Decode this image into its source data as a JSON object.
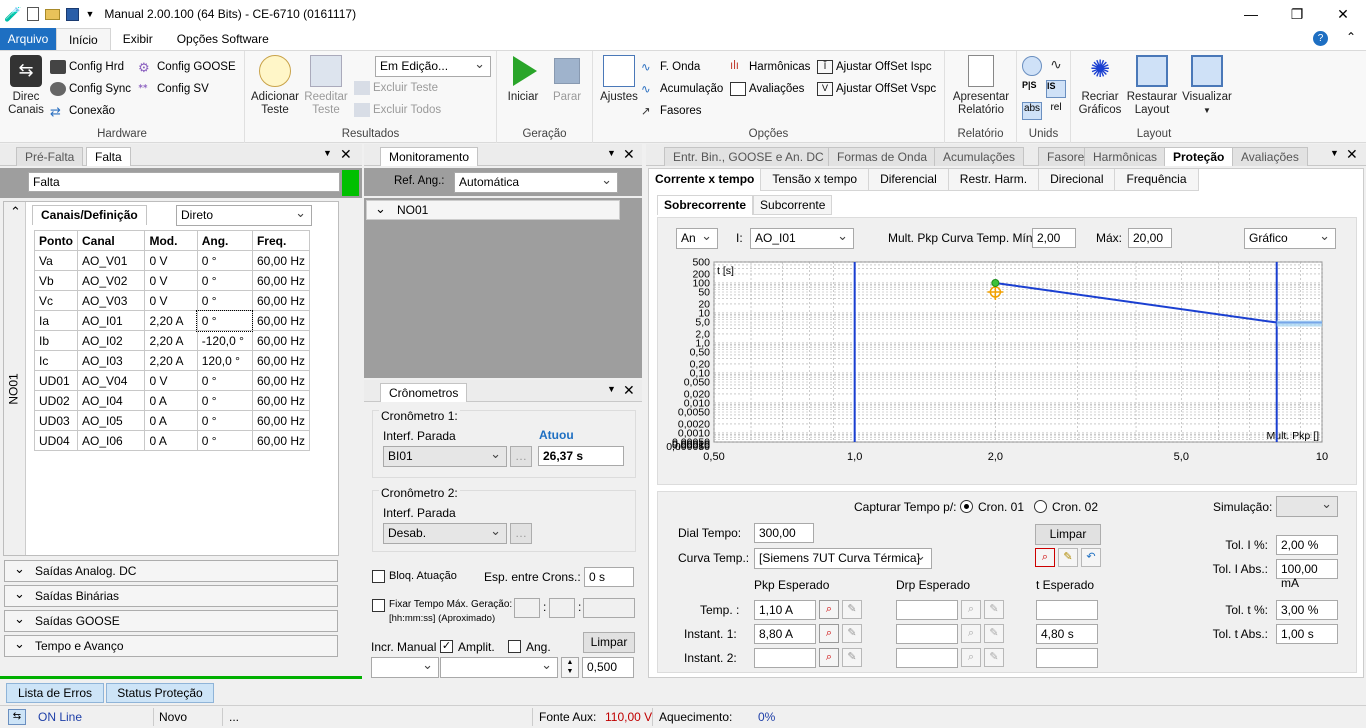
{
  "window": {
    "title": "Manual 2.00.100 (64 Bits) - CE-6710 (0161117)"
  },
  "ribbon_tabs": [
    "Arquivo",
    "Início",
    "Exibir",
    "Opções Software"
  ],
  "ribbon": {
    "hardware": {
      "label": "Hardware",
      "direc": "Direc\nCanais",
      "config_hrd": "Config Hrd",
      "config_sync": "Config Sync",
      "conexao": "Conexão",
      "config_goose": "Config GOOSE",
      "config_sv": "Config SV"
    },
    "resultados": {
      "label": "Resultados",
      "adicionar": "Adicionar\nTeste",
      "reeditar": "Reeditar\nTeste",
      "status": "Em Edição...",
      "excluir_teste": "Excluir Teste",
      "excluir_todos": "Excluir Todos"
    },
    "geracao": {
      "label": "Geração",
      "iniciar": "Iniciar",
      "parar": "Parar"
    },
    "opcoes": {
      "label": "Opções",
      "ajustes": "Ajustes",
      "f_onda": "F. Onda",
      "acumulacao": "Acumulação",
      "fasores": "Fasores",
      "harmonicas": "Harmônicas",
      "avaliacoes": "Avaliações",
      "offset_ispc": "Ajustar OffSet Ispc",
      "offset_vspc": "Ajustar OffSet Vspc"
    },
    "relatorio": {
      "label": "Relatório",
      "apresentar": "Apresentar\nRelatório"
    },
    "unids": {
      "label": "Unids",
      "abs": "abs",
      "rel": "rel"
    },
    "layout": {
      "label": "Layout",
      "recriar": "Recriar\nGráficos",
      "restaurar": "Restaurar\nLayout",
      "visualizar": "Visualizar"
    }
  },
  "left_panel": {
    "tabs": [
      "Pré-Falta",
      "Falta"
    ],
    "state": "Falta",
    "side_label": "NO01",
    "subtab": "Canais/Definição",
    "mode": "Direto",
    "columns": [
      "Ponto",
      "Canal",
      "Mod.",
      "Ang.",
      "Freq."
    ],
    "rows": [
      [
        "Va",
        "AO_V01",
        "0 V",
        "0 °",
        "60,00 Hz"
      ],
      [
        "Vb",
        "AO_V02",
        "0 V",
        "0 °",
        "60,00 Hz"
      ],
      [
        "Vc",
        "AO_V03",
        "0 V",
        "0 °",
        "60,00 Hz"
      ],
      [
        "Ia",
        "AO_I01",
        "2,20 A",
        "0 °",
        "60,00 Hz"
      ],
      [
        "Ib",
        "AO_I02",
        "2,20 A",
        "-120,0 °",
        "60,00 Hz"
      ],
      [
        "Ic",
        "AO_I03",
        "2,20 A",
        "120,0 °",
        "60,00 Hz"
      ],
      [
        "UD01",
        "AO_V04",
        "0 V",
        "0 °",
        "60,00 Hz"
      ],
      [
        "UD02",
        "AO_I04",
        "0 A",
        "0 °",
        "60,00 Hz"
      ],
      [
        "UD03",
        "AO_I05",
        "0 A",
        "0 °",
        "60,00 Hz"
      ],
      [
        "UD04",
        "AO_I06",
        "0 A",
        "0 °",
        "60,00 Hz"
      ]
    ],
    "sections": [
      "Saídas Analog. DC",
      "Saídas Binárias",
      "Saídas GOOSE",
      "Tempo e Avanço"
    ]
  },
  "monitor": {
    "title": "Monitoramento",
    "ref_label": "Ref. Ang.:",
    "ref_value": "Automática",
    "node": "NO01"
  },
  "crono": {
    "title": "Crônometros",
    "c1_title": "Cronômetro 1:",
    "c1_interf": "Interf. Parada",
    "c1_value": "BI01",
    "atuou": "Atuou",
    "c1_time": "26,37 s",
    "c2_title": "Cronômetro 2:",
    "c2_interf": "Interf. Parada",
    "c2_value": "Desab.",
    "bloq": "Bloq. Atuação",
    "esp": "Esp. entre Crons.:",
    "esp_value": "0 s",
    "fixar": "Fixar Tempo Máx. Geração:",
    "fixar_hint": "[hh:mm:ss] (Aproximado)",
    "incr": "Incr. Manual",
    "amplit": "Amplit.",
    "ang": "Ang.",
    "limpar": "Limpar",
    "step": "0,500"
  },
  "right_panel": {
    "tabs": [
      "Entr. Bin., GOOSE e An. DC",
      "Formas de Onda",
      "Acumulações",
      "Fasores",
      "Harmônicas",
      "Proteção",
      "Avaliações"
    ],
    "active_tab": "Proteção",
    "subtabs": [
      "Corrente x tempo",
      "Tensão x tempo",
      "Diferencial",
      "Restr. Harm.",
      "Direcional",
      "Frequência"
    ],
    "subsubtabs": [
      "Sobrecorrente",
      "Subcorrente"
    ],
    "fn": "An",
    "i_label": "I:",
    "i_value": "AO_I01",
    "mult_label": "Mult. Pkp Curva Temp. Mín:",
    "mult_min": "2,00",
    "max_label": "Máx:",
    "mult_max": "20,00",
    "view": "Gráfico",
    "capturar": "Capturar Tempo p/:",
    "cron01": "Cron. 01",
    "cron02": "Cron. 02",
    "simulacao": "Simulação:",
    "dial_label": "Dial Tempo:",
    "dial": "300,00",
    "limpar": "Limpar",
    "curva_label": "Curva Temp.:",
    "curva": "[Siemens 7UT Curva Térmica]",
    "pkp_hdr": "Pkp Esperado",
    "drp_hdr": "Drp Esperado",
    "t_hdr": "t Esperado",
    "rows": [
      {
        "label": "Temp. :",
        "pkp": "1,10 A",
        "drp": "",
        "t": ""
      },
      {
        "label": "Instant. 1:",
        "pkp": "8,80 A",
        "drp": "",
        "t": "4,80 s"
      },
      {
        "label": "Instant. 2:",
        "pkp": "",
        "drp": "",
        "t": ""
      }
    ],
    "tol": [
      {
        "label": "Tol. I %:",
        "value": "2,00 %"
      },
      {
        "label": "Tol. I Abs.:",
        "value": "100,00 mA"
      },
      {
        "label": "Tol. t %:",
        "value": "3,00 %"
      },
      {
        "label": "Tol. t Abs.:",
        "value": "1,00 s"
      }
    ]
  },
  "chart_data": {
    "type": "line",
    "x_scale": "log",
    "y_scale": "log",
    "ylabel": "t [s]",
    "xlabel": "Mult. Pkp []",
    "xlim": [
      0.5,
      10
    ],
    "ylim": [
      0.0005,
      500
    ],
    "x_ticks": [
      "0,50",
      "1,0",
      "2,0",
      "5,0",
      "10"
    ],
    "y_ticks": [
      "500",
      "200",
      "100",
      "50",
      "20",
      "10",
      "5,0",
      "2,0",
      "1,0",
      "0,50",
      "0,20",
      "0,10",
      "0,050",
      "0,020",
      "0,010",
      "0,0050",
      "0,0020",
      "0,0010",
      "0,00050",
      "0,00020",
      "0,00010",
      "0,000050"
    ],
    "series": [
      {
        "x": [
          2.0,
          8.0,
          8.0,
          10.0
        ],
        "y": [
          100,
          4.8,
          4.8,
          4.8
        ]
      }
    ],
    "vertical_lines": [
      1.0,
      8.0
    ],
    "marker_point": {
      "x": 2.0,
      "y": 100
    },
    "test_point": {
      "x": 2.0,
      "y": 50
    },
    "colors": {
      "curve": "#1a3fd1",
      "marker": "#3cc13c",
      "test": "#f2a100"
    }
  },
  "bottom_tabs": [
    "Lista de Erros",
    "Status Proteção"
  ],
  "status": {
    "online": "ON Line",
    "state": "Novo",
    "dots": "...",
    "fonte_label": "Fonte Aux:",
    "fonte": "110,00 V",
    "aquec_label": "Aquecimento:",
    "aquec": "0%"
  },
  "colors": {
    "accent": "#1e6fc2",
    "green": "#00b000"
  }
}
